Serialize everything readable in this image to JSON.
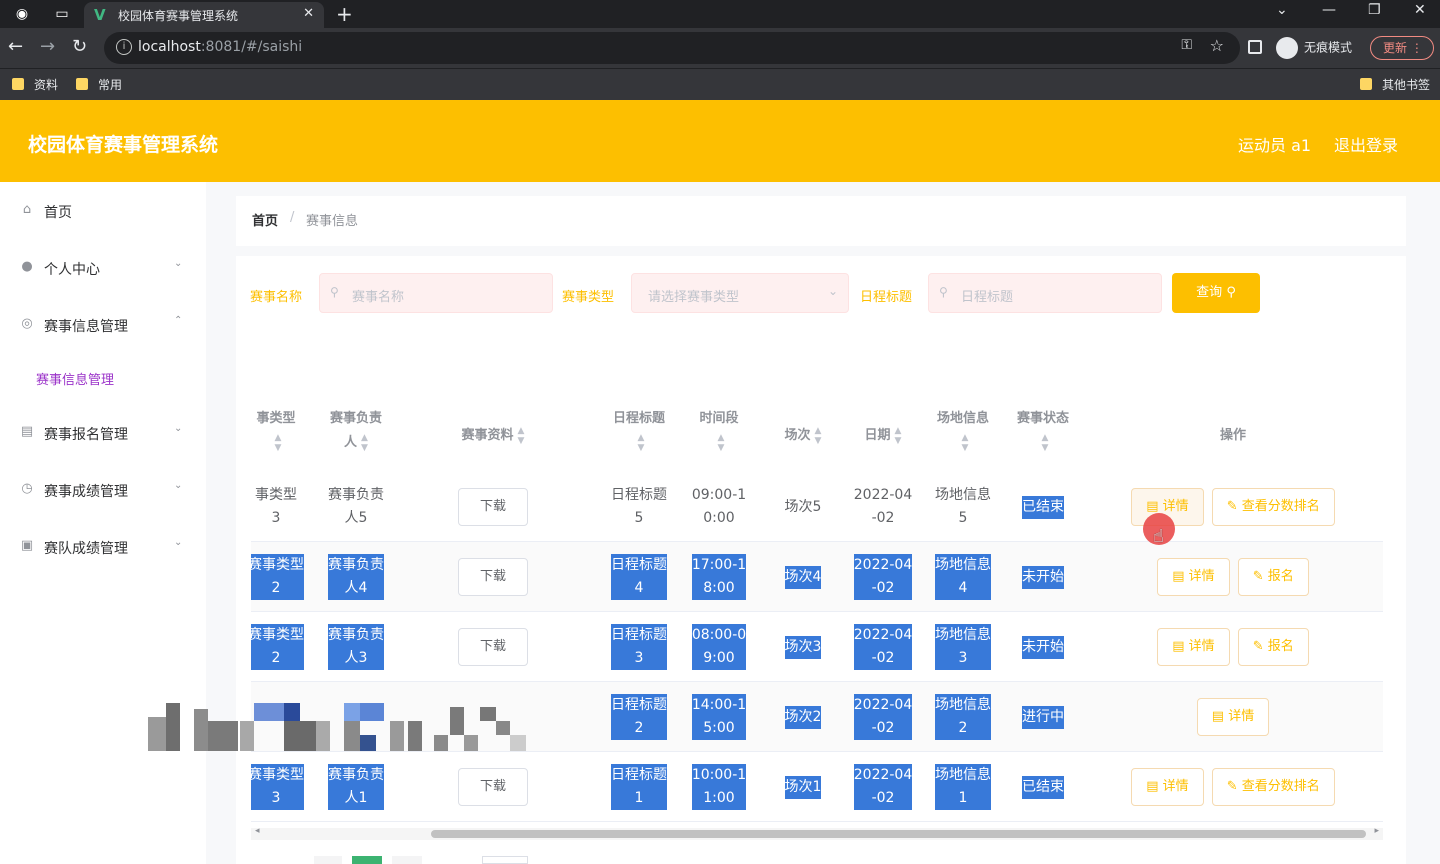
{
  "browser": {
    "tab_title": "校园体育赛事管理系统",
    "url_host": "localhost",
    "url_rest": ":8081/#/saishi",
    "incognito_label": "无痕模式",
    "update_label": "更新",
    "bookmarks": [
      "资料",
      "常用"
    ],
    "other_bookmarks": "其他书签"
  },
  "header": {
    "title": "校园体育赛事管理系统",
    "user": "运动员 a1",
    "logout": "退出登录",
    "accent_color": "#fdbf00"
  },
  "sidebar": {
    "items": [
      {
        "label": "首页",
        "icon": "home-icon"
      },
      {
        "label": "个人中心",
        "icon": "user-icon"
      },
      {
        "label": "赛事信息管理",
        "icon": "compass-icon"
      },
      {
        "label": "赛事报名管理",
        "icon": "clipboard-icon"
      },
      {
        "label": "赛事成绩管理",
        "icon": "clock-icon"
      },
      {
        "label": "赛队成绩管理",
        "icon": "document-icon"
      }
    ],
    "sub_item": "赛事信息管理"
  },
  "breadcrumb": {
    "home": "首页",
    "separator": "/",
    "current": "赛事信息"
  },
  "filters": {
    "name_label": "赛事名称",
    "name_placeholder": "赛事名称",
    "type_label": "赛事类型",
    "type_placeholder": "请选择赛事类型",
    "schedule_label": "日程标题",
    "schedule_placeholder": "日程标题",
    "query_label": "查询"
  },
  "table": {
    "headers": {
      "type": "事类型",
      "owner_line1": "赛事负责",
      "owner_line2": "人",
      "material": "赛事资料",
      "schedule": "日程标题",
      "period": "时间段",
      "session": "场次",
      "date": "日期",
      "venue": "场地信息",
      "status": "赛事状态",
      "ops": "操作"
    },
    "download_label": "下载",
    "rows": [
      {
        "type_a": "事类型",
        "type_b": "3",
        "owner_a": "赛事负责",
        "owner_b": "人5",
        "schedule_a": "日程标题",
        "schedule_b": "5",
        "period_a": "09:00-1",
        "period_b": "0:00",
        "session": "场次5",
        "date_a": "2022-04",
        "date_b": "-02",
        "venue_a": "场地信息",
        "venue_b": "5",
        "status": "已结束",
        "op1": "详情",
        "op2": "查看分数排名"
      },
      {
        "type_a": "赛事类型",
        "type_b": "2",
        "owner_a": "赛事负责",
        "owner_b": "人4",
        "schedule_a": "日程标题",
        "schedule_b": "4",
        "period_a": "17:00-1",
        "period_b": "8:00",
        "session": "场次4",
        "date_a": "2022-04",
        "date_b": "-02",
        "venue_a": "场地信息",
        "venue_b": "4",
        "status": "未开始",
        "op1": "详情",
        "op2": "报名"
      },
      {
        "type_a": "赛事类型",
        "type_b": "2",
        "owner_a": "赛事负责",
        "owner_b": "人3",
        "schedule_a": "日程标题",
        "schedule_b": "3",
        "period_a": "08:00-0",
        "period_b": "9:00",
        "session": "场次3",
        "date_a": "2022-04",
        "date_b": "-02",
        "venue_a": "场地信息",
        "venue_b": "3",
        "status": "未开始",
        "op1": "详情",
        "op2": "报名"
      },
      {
        "schedule_a": "日程标题",
        "schedule_b": "2",
        "period_a": "14:00-1",
        "period_b": "5:00",
        "session": "场次2",
        "date_a": "2022-04",
        "date_b": "-02",
        "venue_a": "场地信息",
        "venue_b": "2",
        "status": "进行中",
        "op1": "详情"
      },
      {
        "type_a": "赛事类型",
        "type_b": "3",
        "owner_a": "赛事负责",
        "owner_b": "人1",
        "schedule_a": "日程标题",
        "schedule_b": "1",
        "period_a": "10:00-1",
        "period_b": "1:00",
        "session": "场次1",
        "date_a": "2022-04",
        "date_b": "-02",
        "venue_a": "场地信息",
        "venue_b": "1",
        "status": "已结束",
        "op1": "详情",
        "op2": "查看分数排名"
      }
    ]
  }
}
